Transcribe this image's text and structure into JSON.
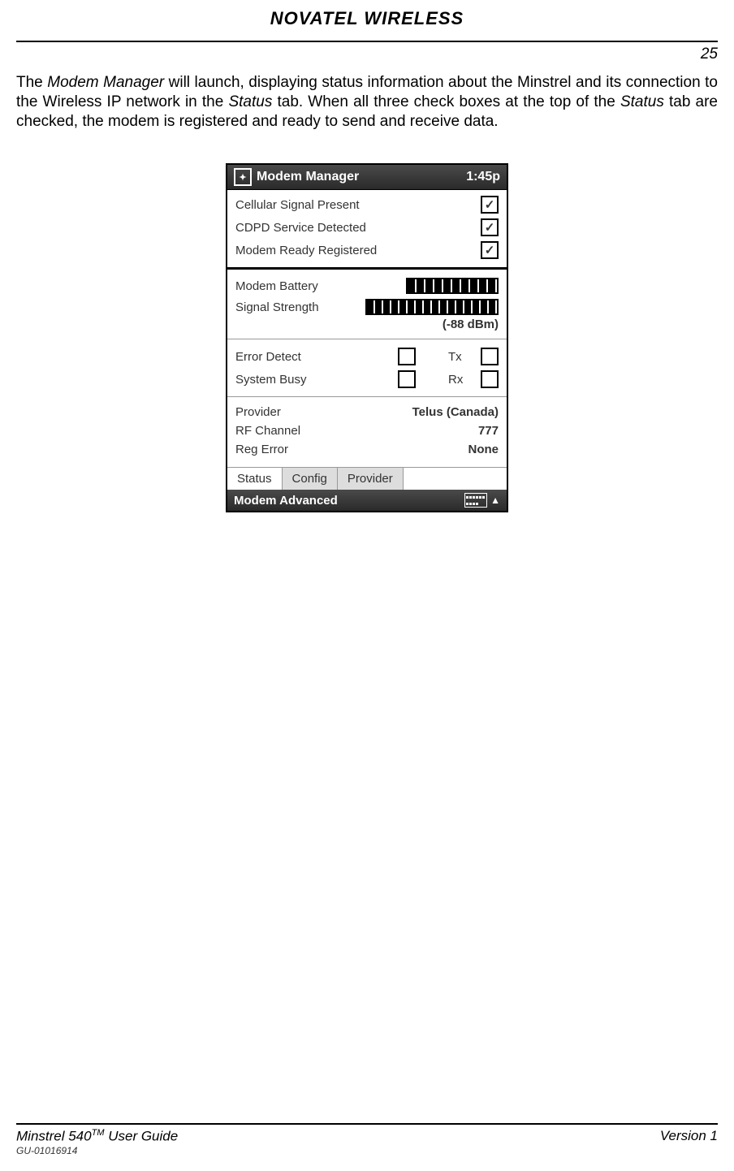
{
  "header": {
    "logo": "NOVATEL WIRELESS",
    "page_number": "25"
  },
  "paragraph": {
    "p1a": "The ",
    "p1b": "Modem Manager",
    "p1c": " will launch, displaying status information about the Minstrel and its connection to the Wireless IP network in the ",
    "p1d": "Status",
    "p1e": " tab.  When all three check boxes at the top of the ",
    "p1f": "Status",
    "p1g": " tab are checked, the modem is registered and ready to send and receive data."
  },
  "pda": {
    "title": "Modem Manager",
    "time": "1:45p",
    "status_checks": [
      {
        "label": "Cellular Signal Present",
        "checked": true
      },
      {
        "label": "CDPD Service Detected",
        "checked": true
      },
      {
        "label": "Modem Ready Registered",
        "checked": true
      }
    ],
    "battery_label": "Modem Battery",
    "signal_label": "Signal Strength",
    "signal_dbm": "(-88 dBm)",
    "flags": {
      "error_detect": "Error Detect",
      "system_busy": "System Busy",
      "tx": "Tx",
      "rx": "Rx"
    },
    "info": {
      "provider_label": "Provider",
      "provider_value": "Telus (Canada)",
      "rf_label": "RF Channel",
      "rf_value": "777",
      "reg_label": "Reg Error",
      "reg_value": "None"
    },
    "tabs": [
      "Status",
      "Config",
      "Provider"
    ],
    "bottom": "Modem Advanced"
  },
  "footer": {
    "left_a": "Minstrel 540",
    "left_sup": "TM",
    "left_b": " User Guide",
    "right": "Version 1",
    "sub": "GU-01016914"
  }
}
